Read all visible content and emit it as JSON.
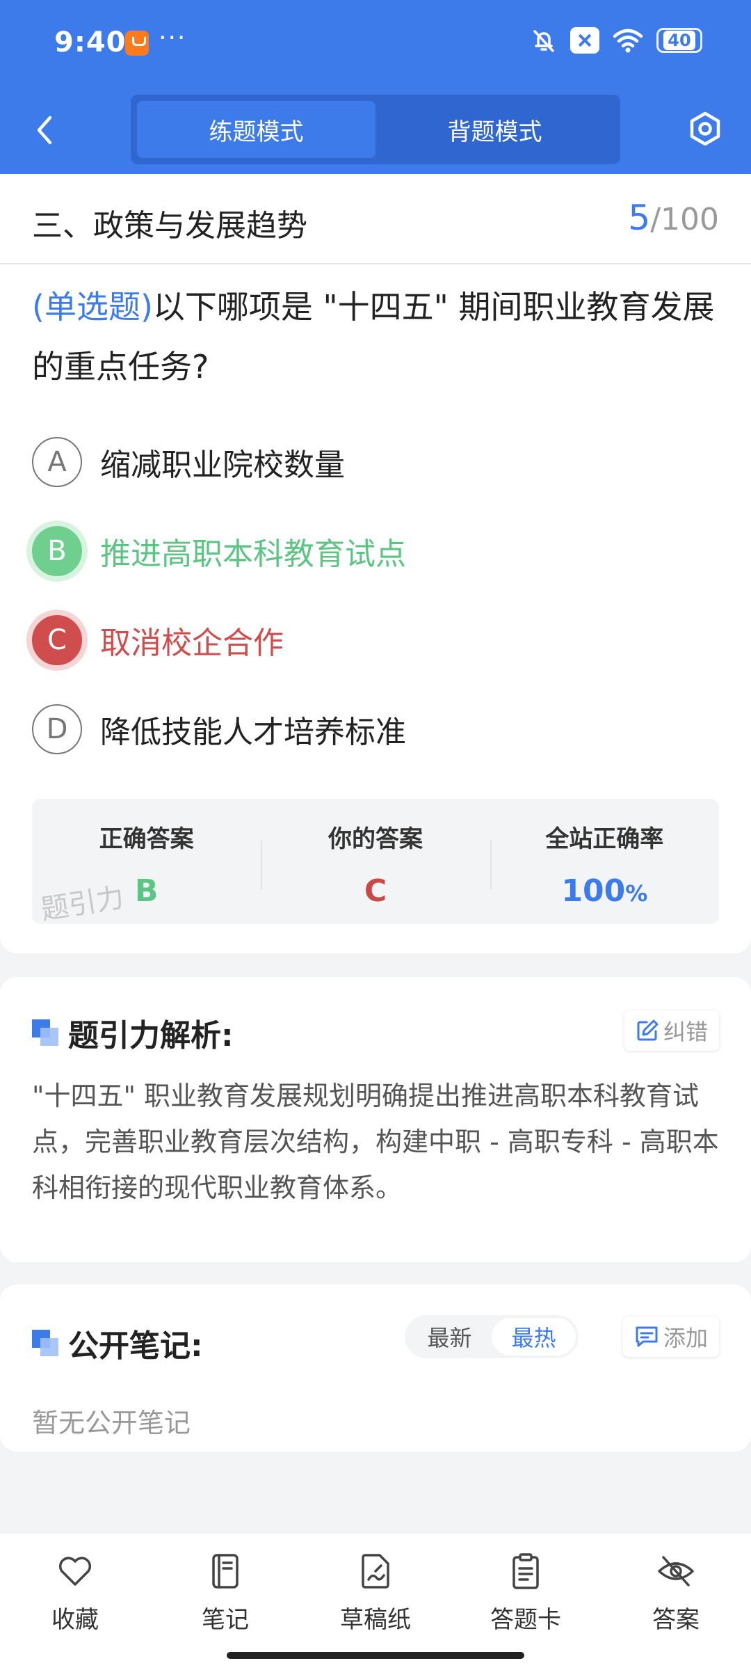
{
  "status_bar": {
    "time": "9:40",
    "battery": "40"
  },
  "nav": {
    "tabs": [
      {
        "label": "练题模式",
        "active": true
      },
      {
        "label": "背题模式",
        "active": false
      }
    ]
  },
  "section": {
    "title": "三、政策与发展趋势",
    "current": "5",
    "total": "/100"
  },
  "question": {
    "type": "(单选题)",
    "text": "以下哪项是 \"十四五\" 期间职业教育发展的重点任务?",
    "options": [
      {
        "letter": "A",
        "text": "缩减职业院校数量",
        "state": "normal"
      },
      {
        "letter": "B",
        "text": "推进高职本科教育试点",
        "state": "correct"
      },
      {
        "letter": "C",
        "text": "取消校企合作",
        "state": "wrong"
      },
      {
        "letter": "D",
        "text": "降低技能人才培养标准",
        "state": "normal"
      }
    ]
  },
  "stats": {
    "correct_label": "正确答案",
    "correct_value": "B",
    "yours_label": "你的答案",
    "yours_value": "C",
    "rate_label": "全站正确率",
    "rate_value": "100",
    "rate_unit": "%",
    "watermark": "题引力"
  },
  "analysis": {
    "title": "题引力解析:",
    "report_label": "纠错",
    "text": "\"十四五\" 职业教育发展规划明确提出推进高职本科教育试点，完善职业教育层次结构，构建中职 - 高职专科 - 高职本科相衔接的现代职业教育体系。"
  },
  "notes": {
    "title": "公开笔记:",
    "sort_options": [
      {
        "label": "最新",
        "active": false
      },
      {
        "label": "最热",
        "active": true
      }
    ],
    "add_label": "添加",
    "empty_text": "暂无公开笔记"
  },
  "bottom_bar": {
    "items": [
      {
        "label": "收藏",
        "icon": "heart-icon"
      },
      {
        "label": "笔记",
        "icon": "notebook-icon"
      },
      {
        "label": "草稿纸",
        "icon": "draft-paper-icon"
      },
      {
        "label": "答题卡",
        "icon": "answer-card-icon"
      },
      {
        "label": "答案",
        "icon": "eye-off-icon"
      }
    ]
  },
  "colors": {
    "primary": "#3d7bea",
    "correct": "#5cc584",
    "wrong": "#cf4d4d"
  }
}
